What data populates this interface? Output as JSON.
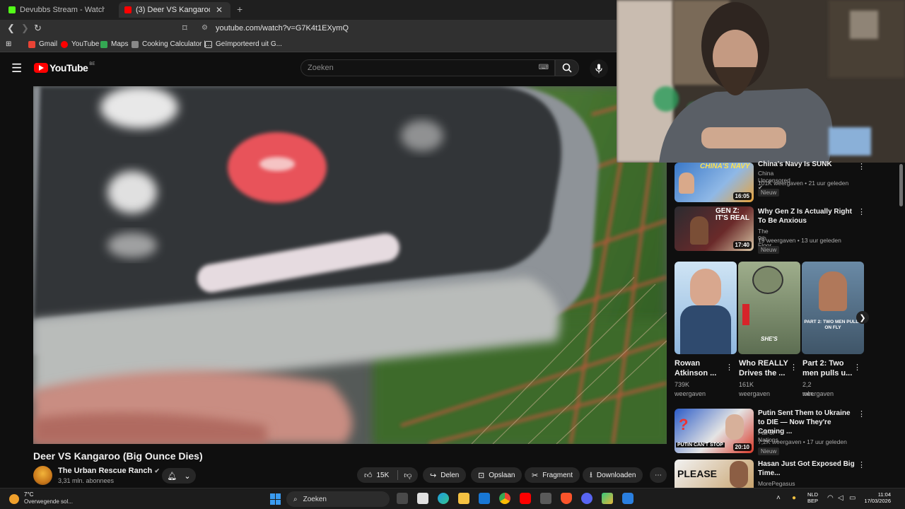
{
  "browser": {
    "tabs": [
      {
        "title": "Devubbs Stream - Watch Live on",
        "active": false,
        "favicon_color": "#53fc18"
      },
      {
        "title": "(3) Deer VS Kangaroo (Big O",
        "active": true,
        "favicon_color": "#ff0000"
      }
    ],
    "url": "youtube.com/watch?v=G7K4t1EXymQ",
    "bookmarks": [
      {
        "label": "Gmail",
        "icon": "gmail-icon",
        "color": "#ea4335"
      },
      {
        "label": "YouTube",
        "icon": "youtube-icon",
        "color": "#ff0000"
      },
      {
        "label": "Maps",
        "icon": "maps-icon",
        "color": "#34a853"
      },
      {
        "label": "Cooking Calculator |...",
        "icon": "calculator-icon",
        "color": "#888888"
      },
      {
        "label": "Geïmporteerd uit G...",
        "icon": "folder-icon",
        "color": "#cccccc"
      }
    ]
  },
  "youtube": {
    "logo_text": "YouTube",
    "region_code": "BE",
    "search_placeholder": "Zoeken"
  },
  "video": {
    "title": "Deer VS Kangaroo (Big Ounce Dies)",
    "channel": "The Urban Rescue Ranch",
    "subscribers": "3,31 mln. abonnees",
    "likes": "15K",
    "actions": {
      "share": "Delen",
      "save": "Opslaan",
      "clip": "Fragment",
      "download": "Downloaden"
    }
  },
  "sidebar": {
    "videos_top": [
      {
        "title": "China's Navy Is SUNK",
        "channel": "China Uncensored",
        "meta": "101K weergaven • 21 uur geleden",
        "badge": "Nieuw",
        "duration": "16:05",
        "thumb_text": "CHINA'S NAVY"
      },
      {
        "title": "Why Gen Z Is Actually Right To Be Anxious",
        "channel": "The 9th Floor",
        "meta": "19 weergaven • 13 uur geleden",
        "badge": "Nieuw",
        "duration": "17:40",
        "thumb_text": "GEN Z: IT'S REAL"
      }
    ],
    "shorts": [
      {
        "title": "Rowan Atkinson ...",
        "views": "739K",
        "views_label": "weergaven"
      },
      {
        "title": "Who REALLY Drives the ...",
        "views": "161K",
        "views_label": "weergaven",
        "thumb_text": "SHE'S"
      },
      {
        "title": "Part 2: Two men pulls u...",
        "views": "2,2 mln.",
        "views_label": "weergaven",
        "thumb_text": "PART 2: TWO MEN PULLS ON FLY"
      }
    ],
    "videos_bottom": [
      {
        "title": "Putin Sent Them to Ukraine to DIE — Now They're Coming ...",
        "channel": "Fall of Nations",
        "meta": "7,2K weergaven • 17 uur geleden",
        "badge": "Nieuw",
        "duration": "20:10",
        "thumb_text": "PUTIN CAN'T STOP"
      },
      {
        "title": "Hasan Just Got Exposed Big Time...",
        "channel": "MorePegasus",
        "thumb_text": "PLEASE"
      }
    ]
  },
  "taskbar": {
    "weather_temp": "7°C",
    "weather_desc": "Overwegende sol...",
    "search_label": "Zoeken",
    "language": "NLD",
    "language_sub": "BEP",
    "time": "11:04",
    "date": "17/03/2026"
  }
}
